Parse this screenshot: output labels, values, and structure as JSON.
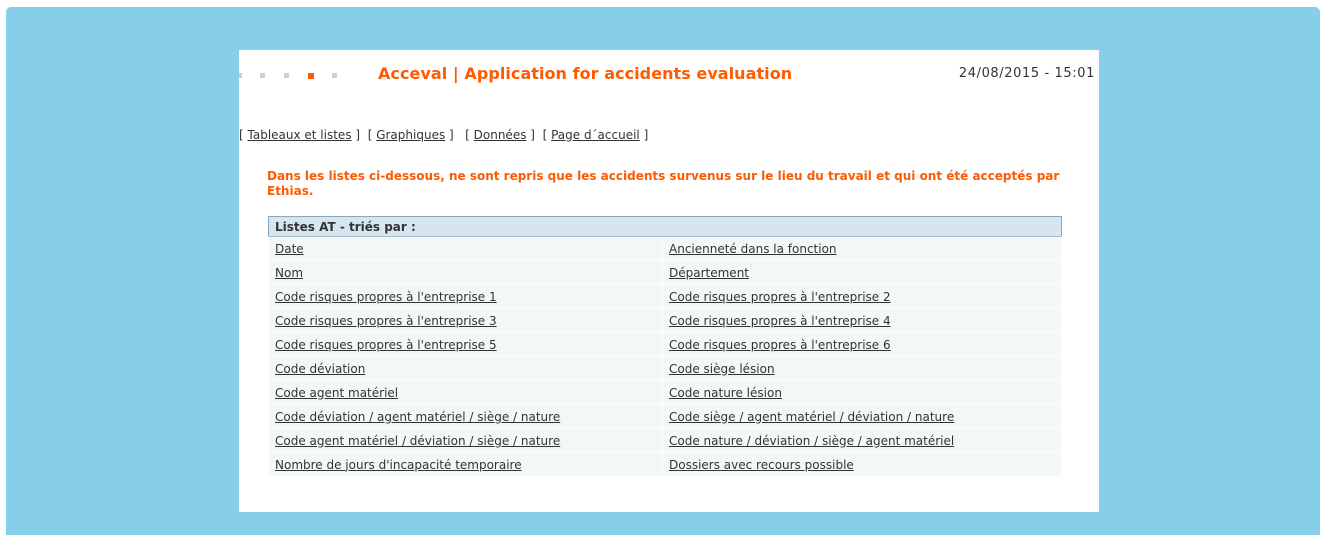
{
  "header": {
    "title": "Acceval | Application for accidents evaluation",
    "datetime": "24/08/2015 - 15:01"
  },
  "nav": {
    "tableaux": "Tableaux et listes",
    "graphiques": "Graphiques",
    "donnees": "Données",
    "accueil": "Page d´accueil"
  },
  "notice": "Dans les listes ci-dessous, ne sont repris que les accidents survenus sur le lieu du travail et qui ont été acceptés par Ethias.",
  "table": {
    "header": "Listes AT - triés par :",
    "rows": [
      [
        "Date",
        "Ancienneté dans la fonction"
      ],
      [
        "Nom",
        "Département"
      ],
      [
        "Code risques propres à l'entreprise 1",
        "Code risques propres à l'entreprise 2"
      ],
      [
        "Code risques propres à l'entreprise 3",
        "Code risques propres à l'entreprise 4"
      ],
      [
        "Code risques propres à l'entreprise 5",
        "Code risques propres à l'entreprise 6"
      ],
      [
        "Code déviation",
        "Code siège lésion"
      ],
      [
        "Code agent matériel",
        "Code nature lésion"
      ],
      [
        "Code déviation / agent matériel / siège / nature",
        "Code siège / agent matériel / déviation / nature"
      ],
      [
        "Code agent matériel / déviation / siège / nature",
        "Code nature / déviation / siège / agent matériel"
      ],
      [
        "Nombre de jours d'incapacité temporaire",
        "Dossiers avec recours possible"
      ]
    ]
  },
  "colors": {
    "frame_background": "#87ceeb",
    "accent_orange": "#ff5a00",
    "table_header_bg": "#d6e6f0",
    "table_cell_bg": "#f2f7f8"
  }
}
